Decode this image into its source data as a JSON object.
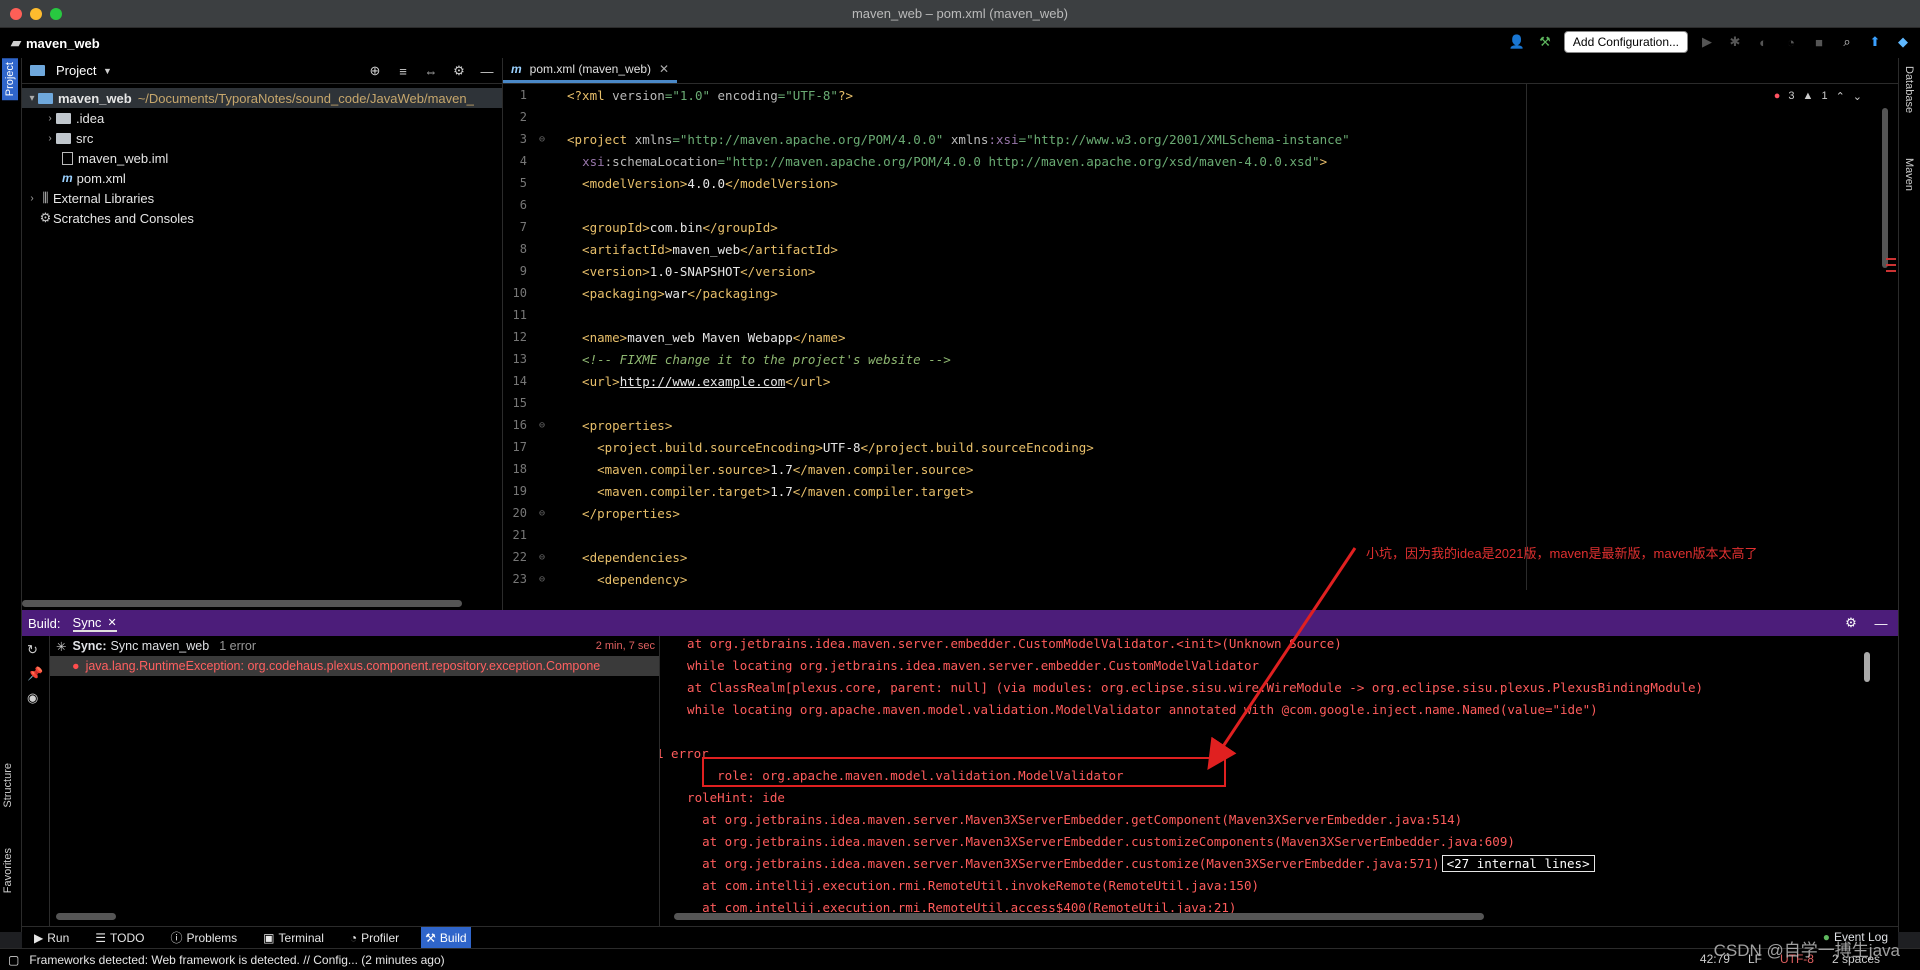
{
  "window": {
    "title": "maven_web – pom.xml (maven_web)"
  },
  "navbar": {
    "project": "maven_web",
    "add_config": "Add Configuration..."
  },
  "left_tabs": {
    "project": "Project",
    "structure": "Structure",
    "favorites": "Favorites"
  },
  "right_tabs": {
    "database": "Database",
    "maven": "Maven"
  },
  "project_panel": {
    "title": "Project",
    "rows": [
      {
        "name": "maven_web",
        "path": "~/Documents/TyporaNotes/sound_code/JavaWeb/maven_"
      },
      {
        "name": ".idea"
      },
      {
        "name": "src"
      },
      {
        "name": "maven_web.iml"
      },
      {
        "name": "pom.xml"
      },
      {
        "name": "External Libraries"
      },
      {
        "name": "Scratches and Consoles"
      }
    ]
  },
  "editor": {
    "tab": "pom.xml (maven_web)",
    "errors": "3",
    "warnings": "1",
    "lines": [
      "1",
      "2",
      "3",
      "4",
      "5",
      "6",
      "7",
      "8",
      "9",
      "10",
      "11",
      "12",
      "13",
      "14",
      "15",
      "16",
      "17",
      "18",
      "19",
      "20",
      "21",
      "22",
      "23"
    ]
  },
  "build": {
    "label": "Build:",
    "tab": "Sync",
    "sync_title": "Sync:",
    "sync_name": "Sync maven_web",
    "sync_errors": "1 error",
    "sync_time": "2 min, 7 sec",
    "exception": "java.lang.RuntimeException: org.codehaus.plexus.component.repository.exception.Compone",
    "console": [
      "  at org.jetbrains.idea.maven.server.embedder.CustomModelValidator.<init>(Unknown Source)",
      "  while locating org.jetbrains.idea.maven.server.embedder.CustomModelValidator",
      "  at ClassRealm[plexus.core, parent: null] (via modules: org.eclipse.sisu.wire.WireModule -> org.eclipse.sisu.plexus.PlexusBindingModule)",
      "  while locating org.apache.maven.model.validation.ModelValidator annotated with @com.google.inject.name.Named(value=\"ide\")",
      "",
      "1 error",
      "      role: org.apache.maven.model.validation.ModelValidator",
      "  roleHint: ide",
      "    at org.jetbrains.idea.maven.server.Maven3XServerEmbedder.getComponent(Maven3XServerEmbedder.java:514)",
      "    at org.jetbrains.idea.maven.server.Maven3XServerEmbedder.customizeComponents(Maven3XServerEmbedder.java:609)",
      "    at org.jetbrains.idea.maven.server.Maven3XServerEmbedder.customize(Maven3XServerEmbedder.java:571)",
      "    at com.intellij.execution.rmi.RemoteUtil.invokeRemote(RemoteUtil.java:150)",
      "    at com.intellij.execution.rmi.RemoteUtil.access$400(RemoteUtil.java:21)"
    ],
    "internal_lines": "<27 internal lines>"
  },
  "annotation": "小坑，因为我的idea是2021版，maven是最新版，maven版本太高了",
  "bottom_tabs": [
    "Run",
    "TODO",
    "Problems",
    "Terminal",
    "Profiler",
    "Build"
  ],
  "event_log": "Event Log",
  "status": {
    "message": "Frameworks detected: Web framework is detected. // Config... (2 minutes ago)",
    "position": "42:79",
    "line_sep": "LF",
    "encoding": "UTF-8",
    "indent": "2 spaces"
  },
  "watermark": "CSDN @自学一搏生java",
  "colors": {
    "build_header": "#4c1d7a",
    "accent": "#2f65ca",
    "error": "#ff5c5c"
  }
}
